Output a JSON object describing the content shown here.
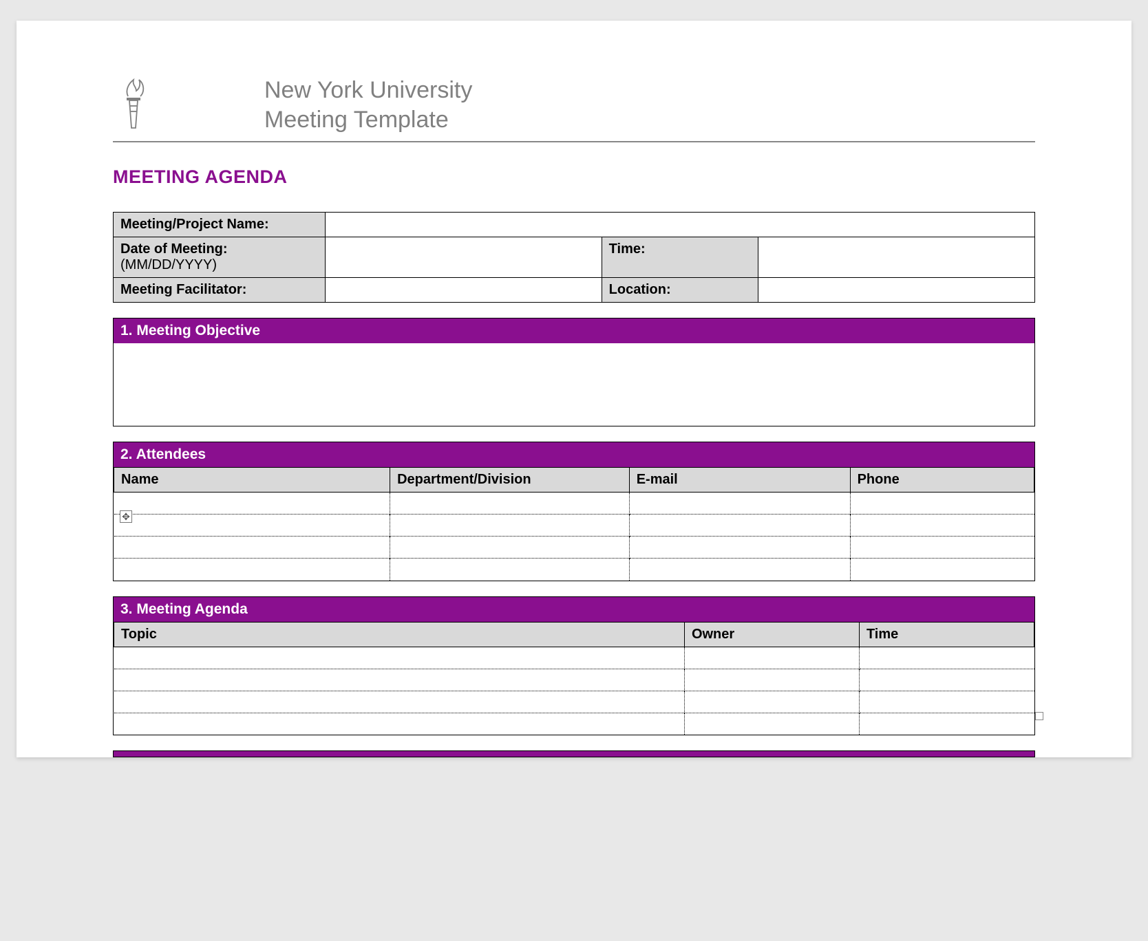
{
  "header": {
    "line1": "New York University",
    "line2": "Meeting Template"
  },
  "title": "MEETING AGENDA",
  "info": {
    "meeting_name_label": "Meeting/Project Name:",
    "meeting_name_value": "",
    "date_label": "Date of Meeting:",
    "date_sub": "(MM/DD/YYYY)",
    "date_value": "",
    "time_label": "Time:",
    "time_value": "",
    "facilitator_label": "Meeting Facilitator:",
    "facilitator_value": "",
    "location_label": "Location:",
    "location_value": ""
  },
  "sections": {
    "objective": {
      "header": "1. Meeting Objective",
      "body": ""
    },
    "attendees": {
      "header": "2. Attendees",
      "cols": {
        "name": "Name",
        "dept": "Department/Division",
        "email": "E-mail",
        "phone": "Phone"
      }
    },
    "agenda": {
      "header": "3. Meeting Agenda",
      "cols": {
        "topic": "Topic",
        "owner": "Owner",
        "time": "Time"
      }
    }
  }
}
